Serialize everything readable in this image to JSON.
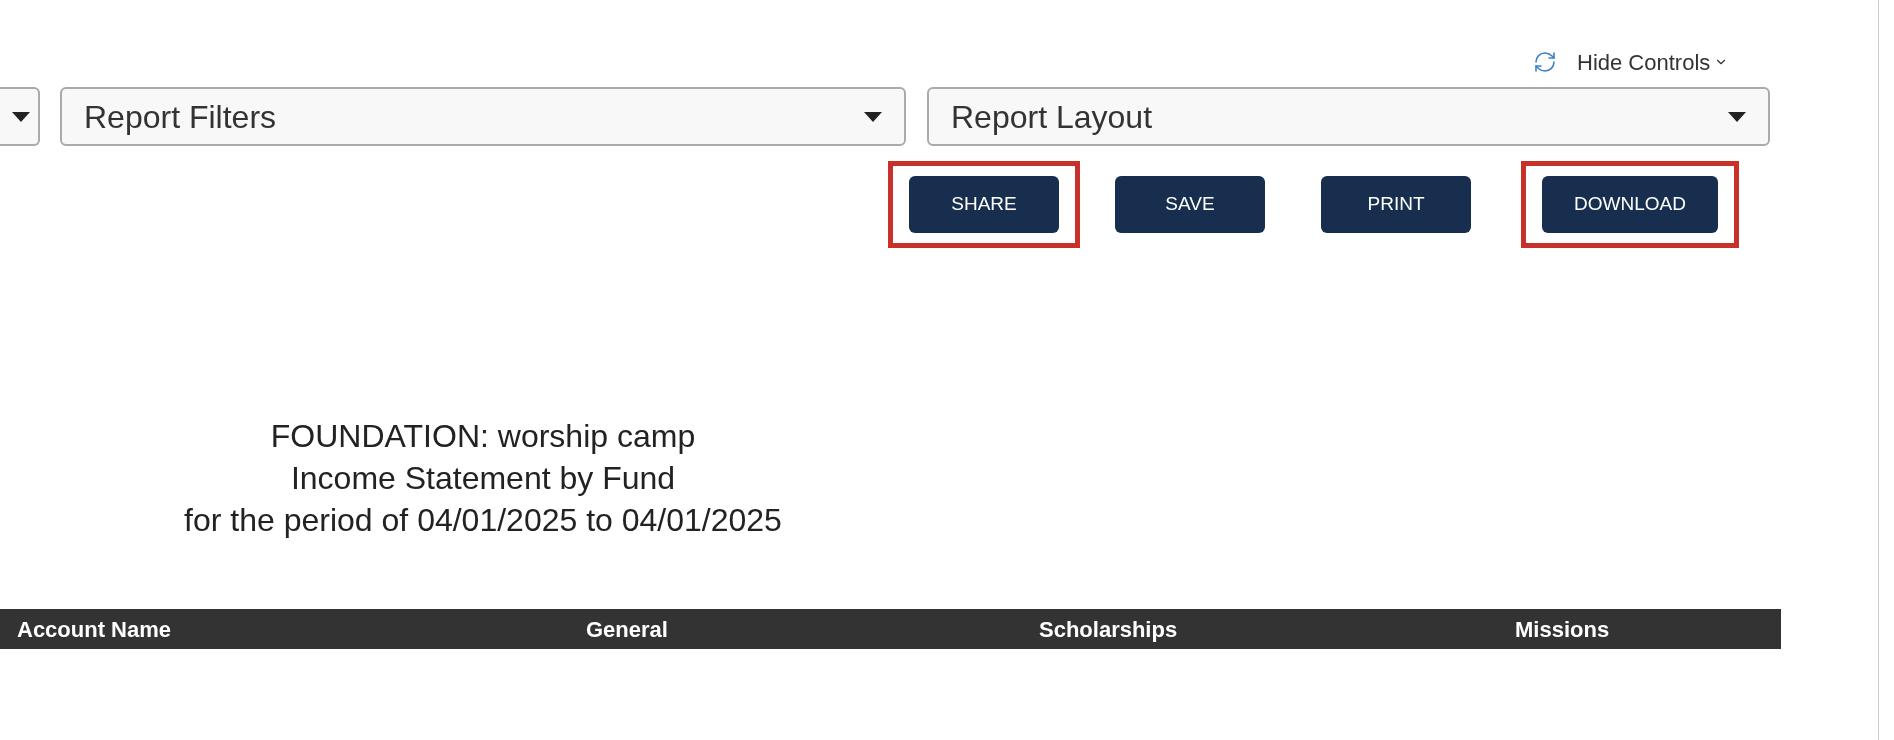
{
  "toolbar": {
    "hide_controls": "Hide Controls"
  },
  "dropdowns": [
    {
      "label": "Report Filters"
    },
    {
      "label": "Report Layout"
    }
  ],
  "buttons": [
    {
      "label": "SHARE",
      "highlighted": true
    },
    {
      "label": "SAVE",
      "highlighted": false
    },
    {
      "label": "PRINT",
      "highlighted": false
    },
    {
      "label": "DOWNLOAD",
      "highlighted": true
    }
  ],
  "report": {
    "title_lines": [
      "FOUNDATION: worship camp",
      "Income Statement by Fund",
      "for the period of 04/01/2025 to 04/01/2025"
    ]
  },
  "table": {
    "columns": [
      "Account Name",
      "General",
      "Scholarships",
      "Missions"
    ]
  }
}
